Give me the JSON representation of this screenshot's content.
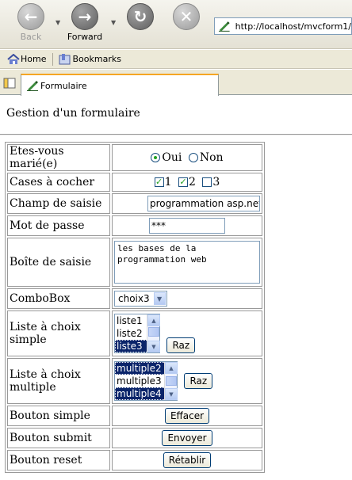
{
  "browser": {
    "back_label": "Back",
    "forward_label": "Forward",
    "url": "http://localhost/mvcform1/",
    "bookmarks": [
      {
        "label": "Home"
      },
      {
        "label": "Bookmarks"
      }
    ],
    "tab_title": "Formulaire"
  },
  "page": {
    "title": "Gestion d'un formulaire"
  },
  "form": {
    "married": {
      "label": "Etes-vous marié(e)",
      "options": [
        "Oui",
        "Non"
      ],
      "selected": "Oui"
    },
    "checkboxes": {
      "label": "Cases à cocher",
      "options": [
        "1",
        "2",
        "3"
      ],
      "checked": [
        "1",
        "2"
      ]
    },
    "text_field": {
      "label": "Champ de saisie",
      "value": "programmation asp.net"
    },
    "password": {
      "label": "Mot de passe",
      "value": "***"
    },
    "textarea": {
      "label": "Boîte de saisie",
      "lines": [
        "les bases de la",
        "programmation web"
      ]
    },
    "combobox": {
      "label": "ComboBox",
      "value": "choix3"
    },
    "single_list": {
      "label": "Liste à choix simple",
      "items": [
        "liste1",
        "liste2",
        "liste3"
      ],
      "selected": [
        "liste3"
      ],
      "button": "Raz"
    },
    "multi_list": {
      "label": "Liste à choix multiple",
      "items": [
        "multiple2",
        "multiple3",
        "multiple4"
      ],
      "selected": [
        "multiple2",
        "multiple4"
      ],
      "button": "Raz"
    },
    "simple_button": {
      "label": "Bouton simple",
      "button": "Effacer"
    },
    "submit_button": {
      "label": "Bouton submit",
      "button": "Envoyer"
    },
    "reset_button": {
      "label": "Bouton reset",
      "button": "Rétablir"
    }
  }
}
